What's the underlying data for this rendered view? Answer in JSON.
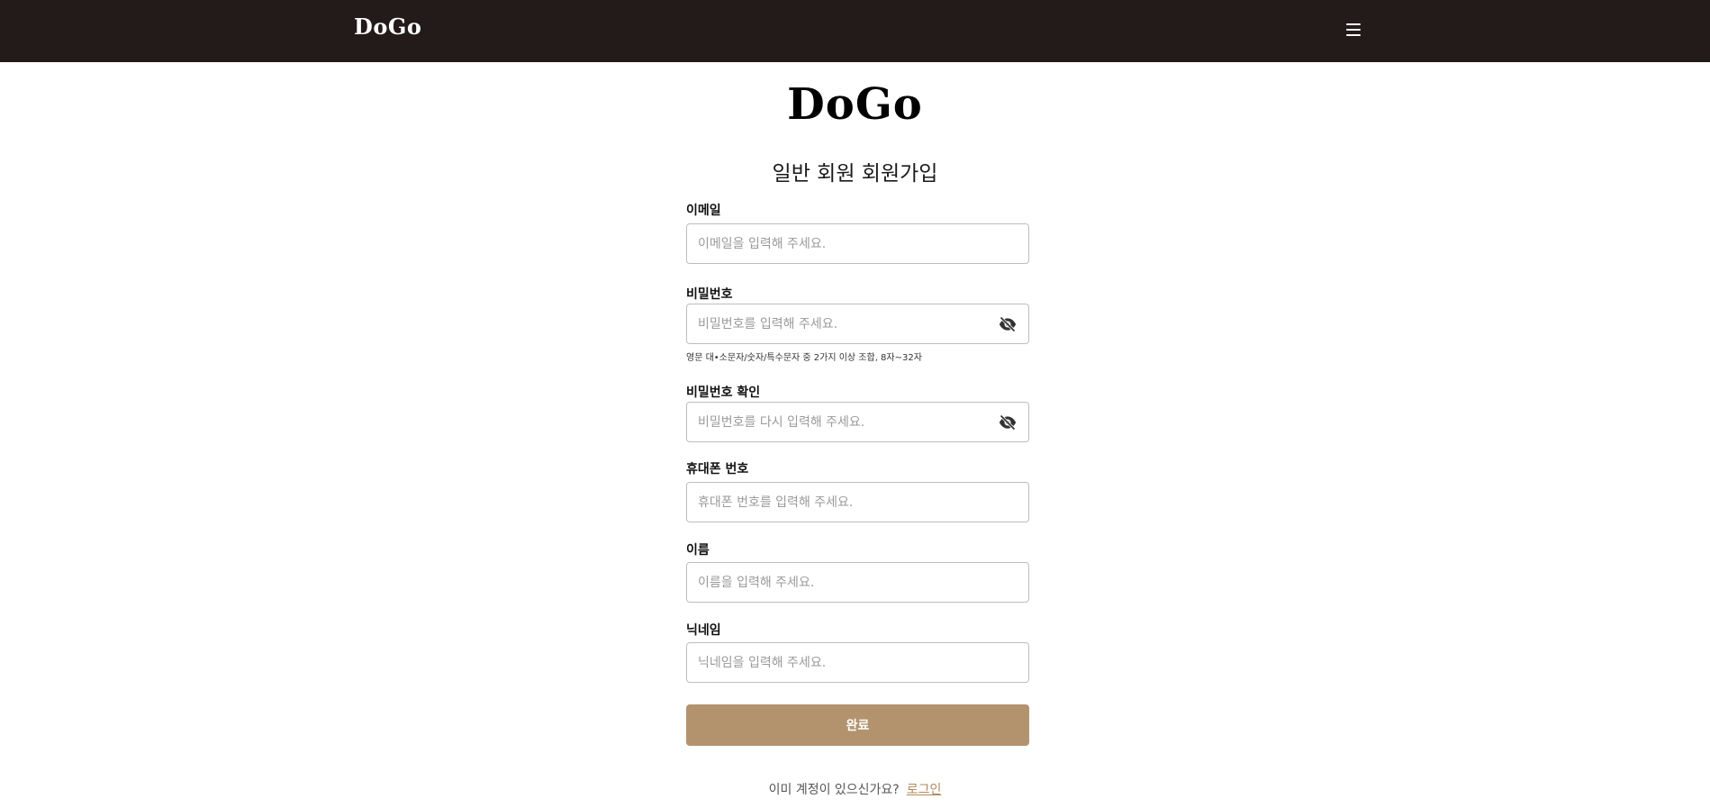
{
  "header": {
    "brand": "DoGo",
    "menu_icon": "hamburger-menu-icon"
  },
  "logo": "DoGo",
  "page_title": "일반 회원 회원가입",
  "fields": {
    "email": {
      "label": "이메일",
      "placeholder": "이메일을 입력해 주세요.",
      "value": ""
    },
    "password": {
      "label": "비밀번호",
      "placeholder": "비밀번호를 입력해 주세요.",
      "value": "",
      "hint": "영문 대•소문자/숫자/특수문자 중 2가지 이상 조합, 8자~32자",
      "toggle_icon": "eye-slash-icon"
    },
    "password_confirm": {
      "label": "비밀번호 확인",
      "placeholder": "비밀번호를 다시 입력해 주세요.",
      "value": "",
      "toggle_icon": "eye-slash-icon"
    },
    "phone": {
      "label": "휴대폰 번호",
      "placeholder": "휴대폰 번호를 입력해 주세요.",
      "value": ""
    },
    "name": {
      "label": "이름",
      "placeholder": "이름을 입력해 주세요.",
      "value": ""
    },
    "nickname": {
      "label": "닉네임",
      "placeholder": "닉네임을 입력해 주세요.",
      "value": ""
    }
  },
  "submit_label": "완료",
  "footer": {
    "question": "이미 계정이 있으신가요?",
    "login_link": "로그인"
  },
  "colors": {
    "header_bg": "#231a1a",
    "accent": "#b3936e",
    "link": "#b08a5c"
  }
}
